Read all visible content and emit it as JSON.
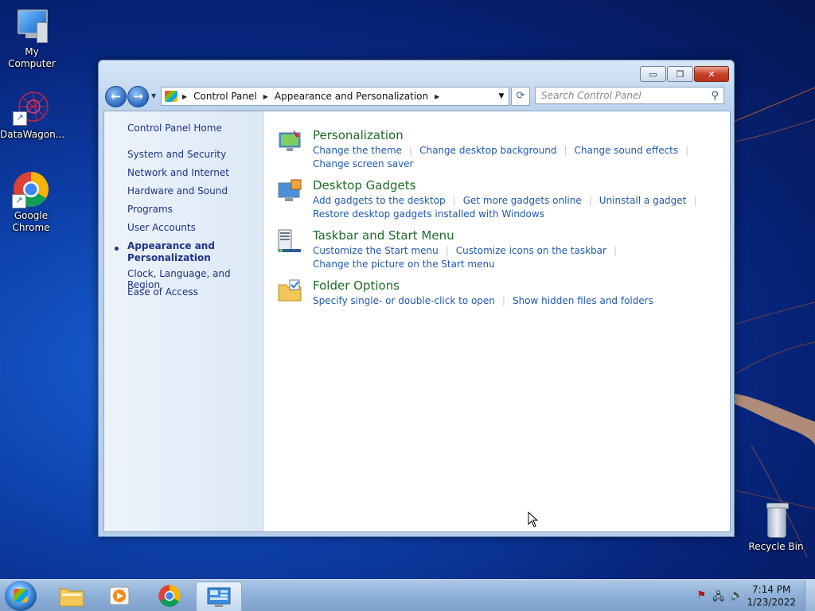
{
  "desktop": {
    "icons": [
      {
        "label": "My Computer"
      },
      {
        "label": "DataWagon..."
      },
      {
        "label": "Google Chrome"
      },
      {
        "label": "Recycle Bin"
      }
    ]
  },
  "window": {
    "minimize": "▭",
    "maximize": "❐",
    "close": "✕",
    "breadcrumb": [
      "Control Panel",
      "Appearance and Personalization"
    ],
    "search_placeholder": "Search Control Panel",
    "sidebar": {
      "items": [
        "Control Panel Home",
        "System and Security",
        "Network and Internet",
        "Hardware and Sound",
        "Programs",
        "User Accounts",
        "Appearance and Personalization",
        "Clock, Language, and Region",
        "Ease of Access"
      ],
      "current": "Appearance and Personalization"
    },
    "sections": [
      {
        "icon": "personalization-icon",
        "title": "Personalization",
        "tasks_line1": [
          "Change the theme",
          "Change desktop background",
          "Change sound effects"
        ],
        "tasks_line2": [
          "Change screen saver"
        ]
      },
      {
        "icon": "gadgets-icon",
        "title": "Desktop Gadgets",
        "tasks_line1": [
          "Add gadgets to the desktop",
          "Get more gadgets online",
          "Uninstall a gadget"
        ],
        "tasks_line2": [
          "Restore desktop gadgets installed with Windows"
        ]
      },
      {
        "icon": "taskbar-icon",
        "title": "Taskbar and Start Menu",
        "tasks_line1": [
          "Customize the Start menu",
          "Customize icons on the taskbar"
        ],
        "tasks_line2": [
          "Change the picture on the Start menu"
        ]
      },
      {
        "icon": "folder-options-icon",
        "title": "Folder Options",
        "tasks_line1": [
          "Specify single- or double-click to open",
          "Show hidden files and folders"
        ],
        "tasks_line2": []
      }
    ]
  },
  "taskbar": {
    "clock_time": "7:14 PM",
    "clock_date": "1/23/2022"
  },
  "colors": {
    "link": "#1f58b3",
    "section_title": "#1e6b26",
    "sidebar_link": "#1e3287"
  }
}
